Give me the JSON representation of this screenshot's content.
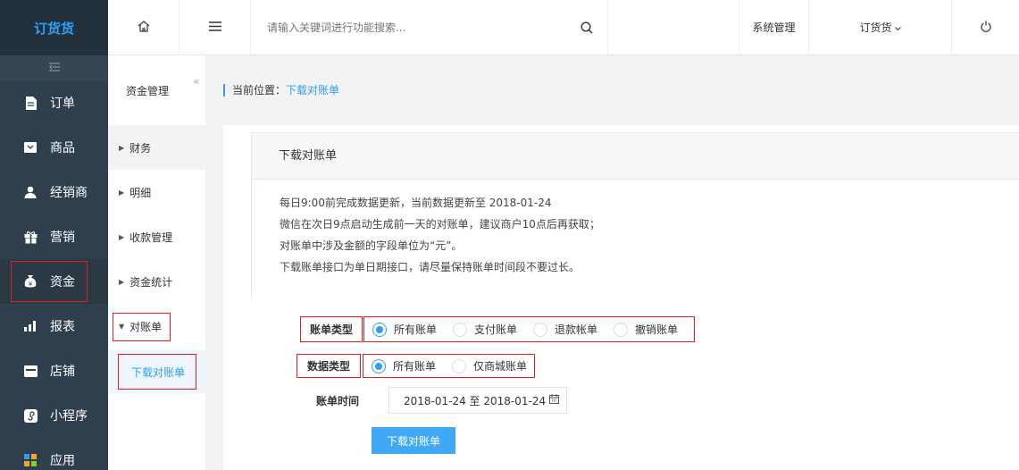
{
  "app": {
    "logo": "订货货"
  },
  "sidebar": {
    "items": [
      {
        "label": "订单",
        "icon": "document-icon"
      },
      {
        "label": "商品",
        "icon": "box-icon"
      },
      {
        "label": "经销商",
        "icon": "user-icon"
      },
      {
        "label": "营销",
        "icon": "gift-icon"
      },
      {
        "label": "资金",
        "icon": "money-bag-icon"
      },
      {
        "label": "报表",
        "icon": "bar-chart-icon"
      },
      {
        "label": "店铺",
        "icon": "store-icon"
      },
      {
        "label": "小程序",
        "icon": "mini-program-icon"
      },
      {
        "label": "应用",
        "icon": "apps-icon"
      }
    ],
    "active_index": 4
  },
  "header": {
    "search_placeholder": "请输入关键词进行功能搜索...",
    "system_menu": "系统管理",
    "account_menu": "订货货"
  },
  "subnav": {
    "title": "资金管理",
    "items": [
      "财务",
      "明细",
      "收款管理",
      "资金统计"
    ],
    "open_group": "对账单",
    "active_child": "下载对账单"
  },
  "breadcrumb": {
    "prefix": "当前位置：",
    "current": "下载对账单"
  },
  "panel": {
    "title": "下载对账单",
    "notes": [
      "每日9:00前完成数据更新，当前数据更新至 2018-01-24",
      "微信在次日9点启动生成前一天的对账单，建议商户10点后再获取；",
      "对账单中涉及金额的字段单位为“元”。",
      "下载账单接口为单日期接口，请尽量保持账单时间段不要过长。"
    ]
  },
  "form": {
    "bill_type": {
      "label": "账单类型",
      "options": [
        "所有账单",
        "支付账单",
        "退款帐单",
        "撤销账单"
      ],
      "selected": 0
    },
    "data_type": {
      "label": "数据类型",
      "options": [
        "所有账单",
        "仅商城账单"
      ],
      "selected": 0
    },
    "bill_time": {
      "label": "账单时间",
      "value": "2018-01-24 至 2018-01-24"
    },
    "submit_label": "下载对账单"
  },
  "colors": {
    "accent": "#2f9ef5",
    "sidebar_bg": "#2f3f4d",
    "highlight_border": "#e02020"
  }
}
